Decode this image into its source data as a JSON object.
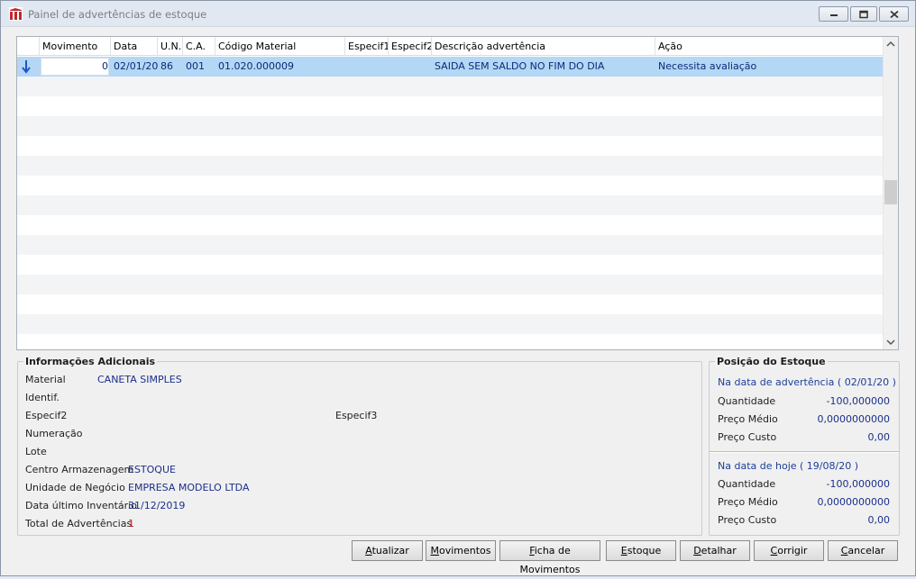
{
  "window": {
    "title": "Painel de advertências de estoque"
  },
  "grid": {
    "columns": [
      "Movimento",
      "Data",
      "U.N.",
      "C.A.",
      "Código Material",
      "Especif1",
      "Especif2",
      "Descrição advertência",
      "Ação"
    ],
    "rows": [
      {
        "movimento": "0",
        "data": "02/01/20",
        "un": "86",
        "ca": "001",
        "codigo": "01.020.000009",
        "especif1": "",
        "especif2": "",
        "descricao": "SAIDA SEM SALDO NO FIM DO DIA",
        "acao": "Necessita avaliação"
      }
    ]
  },
  "info": {
    "title": "Informações Adicionais",
    "material_label": "Material",
    "material_value": "CANETA SIMPLES",
    "identif_label": "Identif.",
    "especif2_label": "Especif2",
    "especif3_label": "Especif3",
    "numeracao_label": "Numeração",
    "lote_label": "Lote",
    "centro_label": "Centro Armazenagem",
    "centro_value": "ESTOQUE",
    "unidade_label": "Unidade de Negócio",
    "unidade_value": "EMPRESA MODELO LTDA",
    "inventario_label": "Data último Inventário",
    "inventario_value": "31/12/2019",
    "total_label": "Total de Advertências",
    "total_value": "1"
  },
  "posicao": {
    "title": "Posição do Estoque",
    "adv_header": "Na data de advertência ( 02/01/20 )",
    "hoje_header": "Na data de hoje ( 19/08/20 )",
    "quantidade_label": "Quantidade",
    "preco_medio_label": "Preço Médio",
    "preco_custo_label": "Preço Custo",
    "adv": {
      "quantidade": "-100,000000",
      "preco_medio": "0,0000000000",
      "preco_custo": "0,00"
    },
    "hoje": {
      "quantidade": "-100,000000",
      "preco_medio": "0,0000000000",
      "preco_custo": "0,00"
    }
  },
  "buttons": {
    "atualizar": {
      "accel": "A",
      "rest": "tualizar"
    },
    "movimentos": {
      "accel": "M",
      "rest": "ovimentos"
    },
    "ficha": {
      "accel": "F",
      "rest": "icha de Movimentos"
    },
    "estoque": {
      "accel": "E",
      "rest": "stoque"
    },
    "detalhar": {
      "accel": "D",
      "rest": "etalhar"
    },
    "corrigir": {
      "accel": "C",
      "rest": "orrigir"
    },
    "cancelar": {
      "accel": "C",
      "rest": "ancelar"
    }
  },
  "colors": {
    "selection": "#b4d7f5",
    "value_text": "#1b2f8a",
    "alert_red": "#d21414",
    "titlebar": "#e2e8f2"
  },
  "icons": [
    "app-logo-icon",
    "minimize-icon",
    "restore-icon",
    "close-icon",
    "row-pointer-arrow-icon",
    "scroll-up-icon",
    "scroll-down-icon"
  ]
}
